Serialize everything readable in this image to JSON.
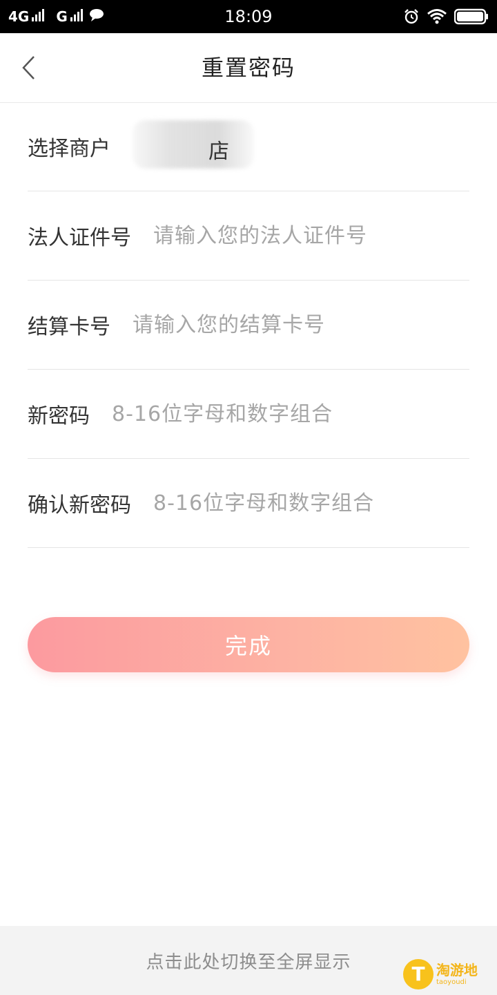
{
  "status_bar": {
    "network1": "4G",
    "network2": "G",
    "time": "18:09",
    "icons": [
      "signal-icon",
      "chat-icon",
      "alarm-icon",
      "wifi-icon",
      "battery-icon"
    ]
  },
  "nav": {
    "title": "重置密码",
    "back_icon": "chevron-left-icon"
  },
  "form": {
    "merchant": {
      "label": "选择商户",
      "value_visible": "店"
    },
    "legal_id": {
      "label": "法人证件号",
      "placeholder": "请输入您的法人证件号"
    },
    "card": {
      "label": "结算卡号",
      "placeholder": "请输入您的结算卡号"
    },
    "new_password": {
      "label": "新密码",
      "placeholder": "8-16位字母和数字组合"
    },
    "confirm_password": {
      "label": "确认新密码",
      "placeholder": "8-16位字母和数字组合"
    }
  },
  "submit": {
    "label": "完成"
  },
  "bottom_bar": {
    "text": "点击此处切换至全屏显示"
  },
  "watermark": {
    "text": "淘游地",
    "sub": "taoyoudi"
  },
  "colors": {
    "button_gradient_start": "#fc9a9f",
    "button_gradient_end": "#ffc2a0",
    "placeholder": "#a6a6a6",
    "label": "#333333"
  }
}
